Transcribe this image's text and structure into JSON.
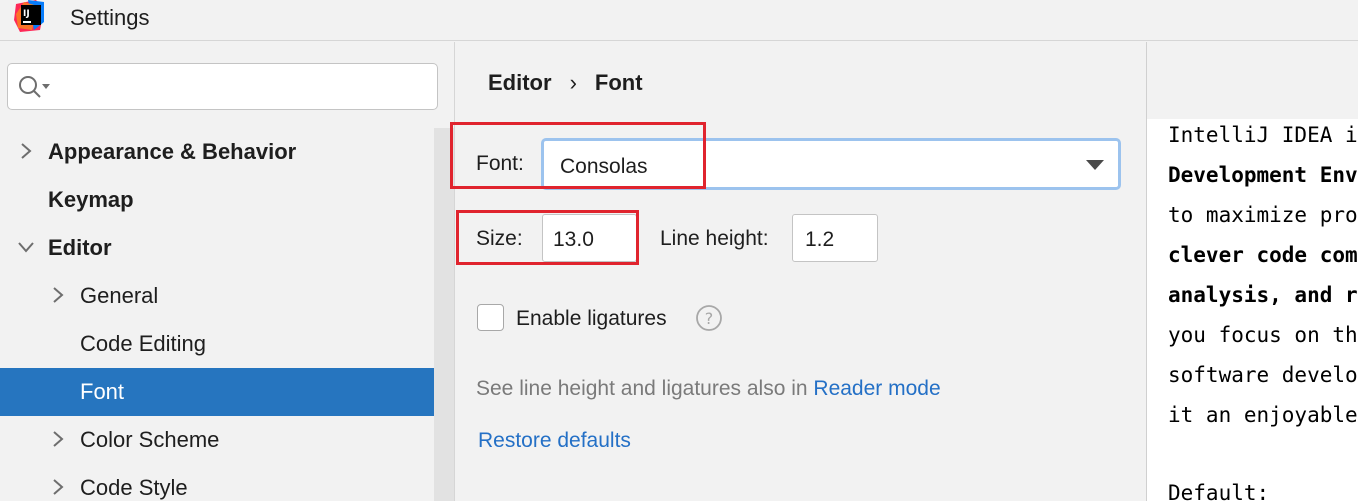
{
  "window": {
    "title": "Settings",
    "app_icon": "intellij-idea-icon"
  },
  "sidebar": {
    "search": {
      "value": "",
      "placeholder": ""
    },
    "items": [
      {
        "label": "Appearance & Behavior",
        "arrow": "right",
        "level": 0,
        "bold": true,
        "selected": false
      },
      {
        "label": "Keymap",
        "arrow": "none",
        "level": 0,
        "bold": true,
        "selected": false
      },
      {
        "label": "Editor",
        "arrow": "down",
        "level": 0,
        "bold": true,
        "selected": false
      },
      {
        "label": "General",
        "arrow": "right",
        "level": 1,
        "bold": false,
        "selected": false
      },
      {
        "label": "Code Editing",
        "arrow": "none",
        "level": 1,
        "bold": false,
        "selected": false
      },
      {
        "label": "Font",
        "arrow": "none",
        "level": 1,
        "bold": false,
        "selected": true
      },
      {
        "label": "Color Scheme",
        "arrow": "right",
        "level": 1,
        "bold": false,
        "selected": false
      },
      {
        "label": "Code Style",
        "arrow": "right",
        "level": 1,
        "bold": false,
        "selected": false
      }
    ]
  },
  "breadcrumb": {
    "parent": "Editor",
    "separator": "›",
    "current": "Font"
  },
  "font_settings": {
    "font_label": "Font:",
    "font_value": "Consolas",
    "size_label": "Size:",
    "size_value": "13.0",
    "line_height_label": "Line height:",
    "line_height_value": "1.2",
    "ligatures_label": "Enable ligatures",
    "ligatures_checked": false,
    "note_prefix": "See line height and ligatures also in",
    "note_link": "Reader mode",
    "restore_label": "Restore defaults"
  },
  "preview": {
    "lines": [
      {
        "text": "IntelliJ IDEA i",
        "bold": false
      },
      {
        "text": "Development Env",
        "bold": true
      },
      {
        "text": "to maximize pro",
        "bold": false
      },
      {
        "text": "clever code com",
        "bold": true
      },
      {
        "text": "analysis, and r",
        "bold": true
      },
      {
        "text": "you focus on th",
        "bold": false
      },
      {
        "text": "software develo",
        "bold": false
      },
      {
        "text": "it an enjoyable",
        "bold": false
      },
      {
        "text": "",
        "bold": false
      },
      {
        "text": "Default:",
        "bold": false
      }
    ]
  },
  "colors": {
    "selection": "#2675bf",
    "link": "#2470c6",
    "highlight_box": "#e0242e",
    "focus_border": "#9cc3ee"
  }
}
